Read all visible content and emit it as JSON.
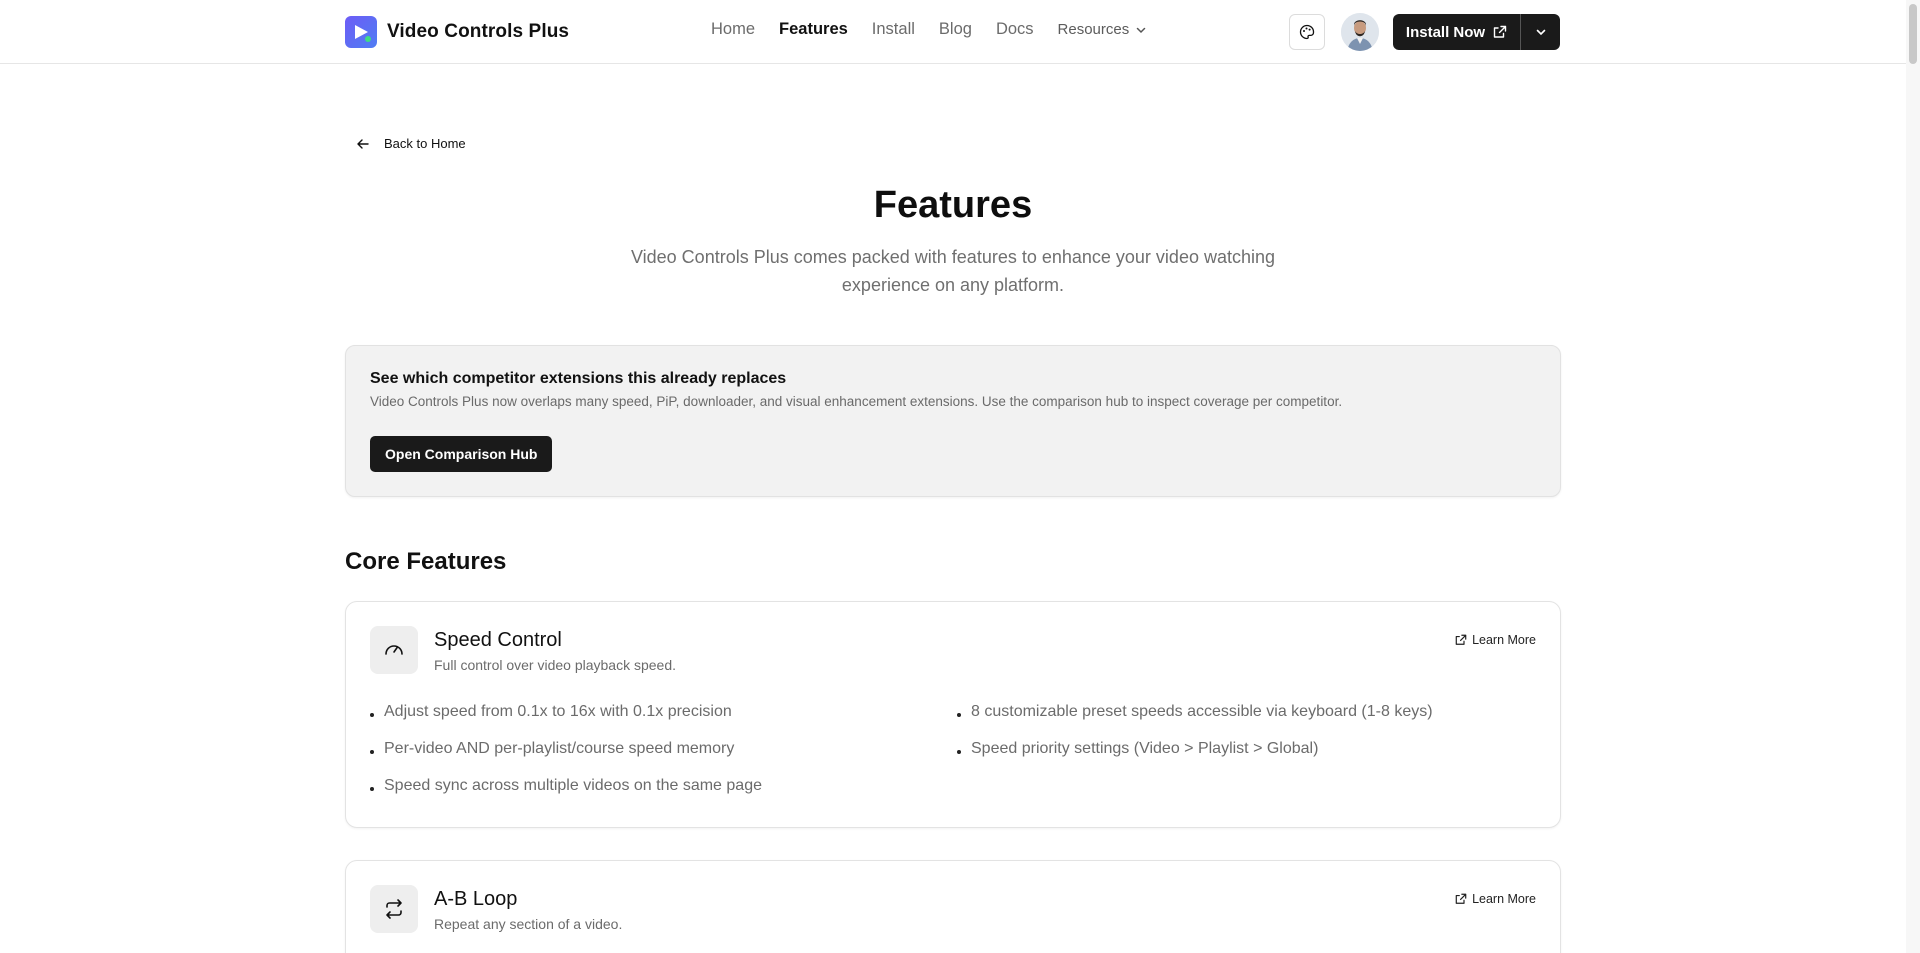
{
  "header": {
    "brand": "Video Controls Plus",
    "nav": [
      {
        "label": "Home",
        "active": false
      },
      {
        "label": "Features",
        "active": true
      },
      {
        "label": "Install",
        "active": false
      },
      {
        "label": "Blog",
        "active": false
      },
      {
        "label": "Docs",
        "active": false
      }
    ],
    "resources_label": "Resources",
    "install_label": "Install Now",
    "theme_icon": "palette-icon",
    "accent": "#6d5cf6"
  },
  "back_label": "Back to Home",
  "page": {
    "title": "Features",
    "subtitle": "Video Controls Plus comes packed with features to enhance your video watching experience on any platform."
  },
  "compare": {
    "title": "See which competitor extensions this already replaces",
    "description": "Video Controls Plus now overlaps many speed, PiP, downloader, and visual enhancement extensions. Use the comparison hub to inspect coverage per competitor.",
    "button": "Open Comparison Hub"
  },
  "section_title": "Core Features",
  "features": [
    {
      "name": "Speed Control",
      "description": "Full control over video playback speed.",
      "icon": "gauge-icon",
      "learn_more": "Learn More",
      "bullets": [
        "Adjust speed from 0.1x to 16x with 0.1x precision",
        "8 customizable preset speeds accessible via keyboard (1-8 keys)",
        "Per-video AND per-playlist/course speed memory",
        "Speed priority settings (Video > Playlist > Global)",
        "Speed sync across multiple videos on the same page"
      ]
    },
    {
      "name": "A-B Loop",
      "description": "Repeat any section of a video.",
      "icon": "repeat-icon",
      "learn_more": "Learn More",
      "bullets": []
    }
  ]
}
